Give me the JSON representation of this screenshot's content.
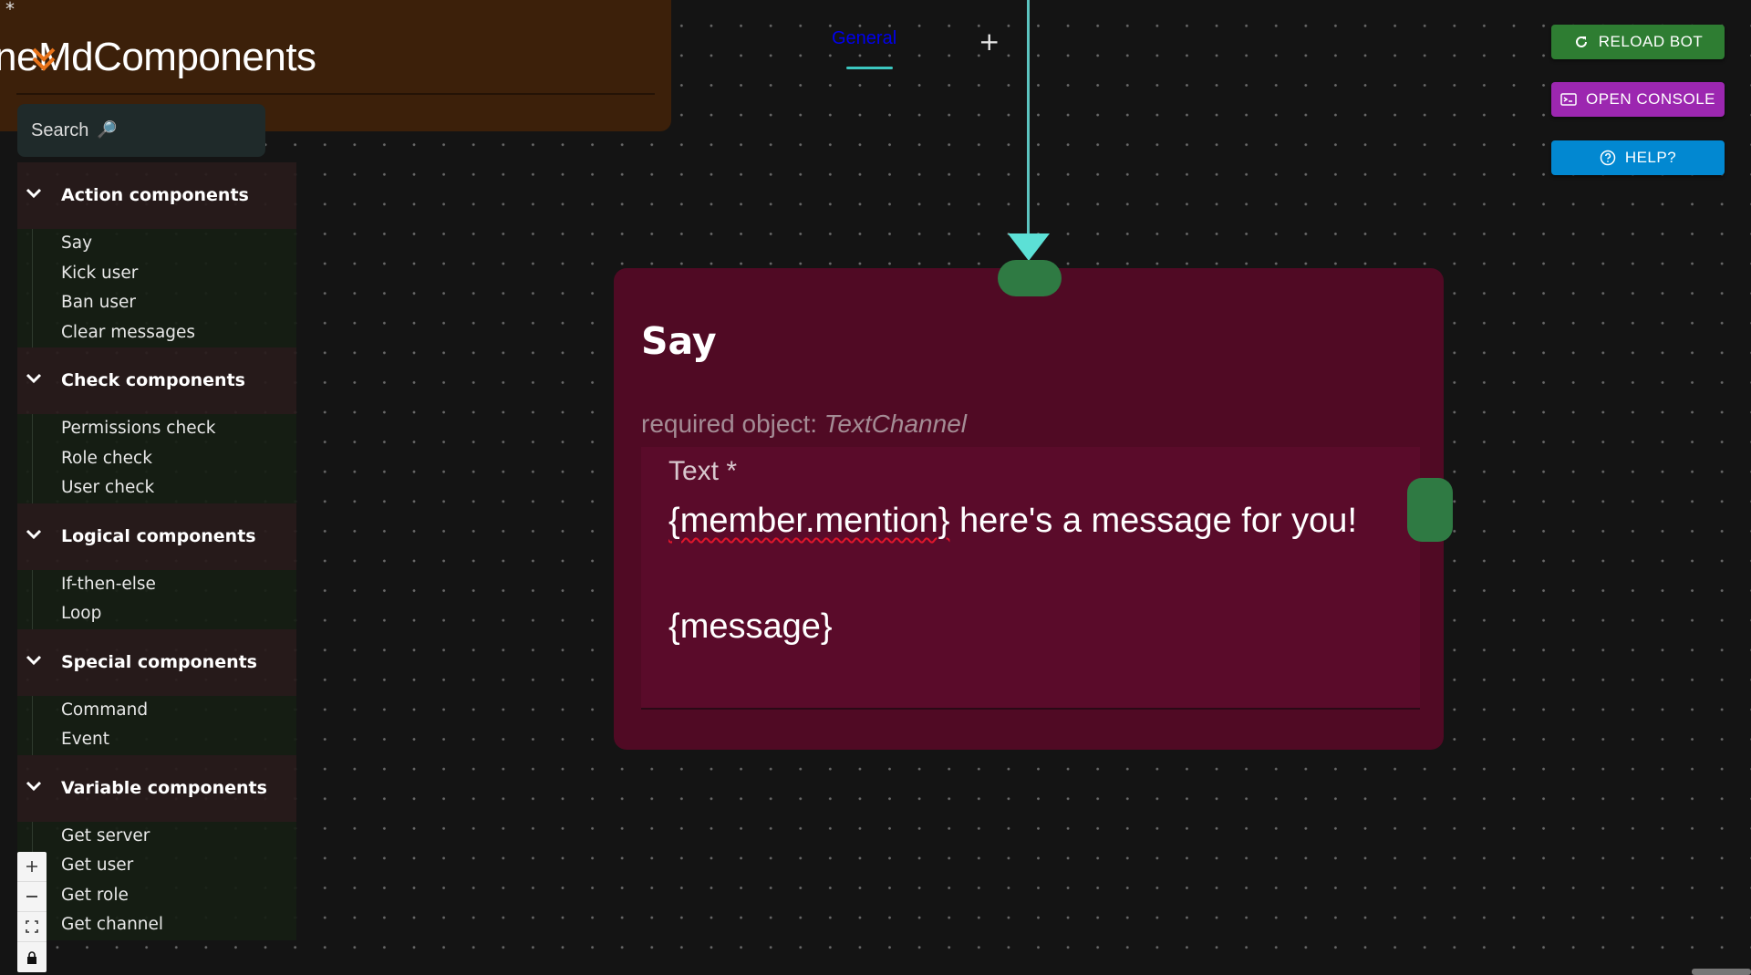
{
  "header": {
    "asterisk": "*",
    "title": "neMdComponents"
  },
  "search": {
    "placeholder": "Search"
  },
  "sidebar": {
    "categories": [
      {
        "label": "Action components",
        "items": [
          "Say",
          "Kick user",
          "Ban user",
          "Clear messages"
        ]
      },
      {
        "label": "Check components",
        "items": [
          "Permissions check",
          "Role check",
          "User check"
        ]
      },
      {
        "label": "Logical components",
        "items": [
          "If-then-else",
          "Loop"
        ]
      },
      {
        "label": "Special components",
        "items": [
          "Command",
          "Event"
        ]
      },
      {
        "label": "Variable components",
        "items": [
          "Get server",
          "Get user",
          "Get role",
          "Get channel"
        ]
      }
    ]
  },
  "tabs": {
    "active": "General",
    "add": "+"
  },
  "node": {
    "title": "Say",
    "required_prefix": "required object:",
    "required_type": "TextChannel",
    "field_label": "Text *",
    "field_mention": "{member.mention}",
    "field_line1_rest": " here's a message for you!",
    "field_line2": "{message}"
  },
  "buttons": {
    "reload": "RELOAD BOT",
    "console": "OPEN CONSOLE",
    "help": "HELP?"
  },
  "colors": {
    "header_bg": "#3c200a",
    "node_bg": "#500a24",
    "handle": "#2f7a43",
    "edge": "#5cc4c0",
    "reload": "#2e7d32",
    "console": "#9c27b0",
    "help": "#0288d1",
    "logo": "#e8731a"
  },
  "icons": {
    "logo": "logo-icon",
    "search": "search-icon",
    "chevron": "chevron-down-icon",
    "reload": "refresh-icon",
    "console": "terminal-icon",
    "help": "help-circle-icon",
    "zoom_in": "plus-icon",
    "zoom_out": "minus-icon",
    "fit": "fit-view-icon",
    "lock": "lock-icon"
  }
}
